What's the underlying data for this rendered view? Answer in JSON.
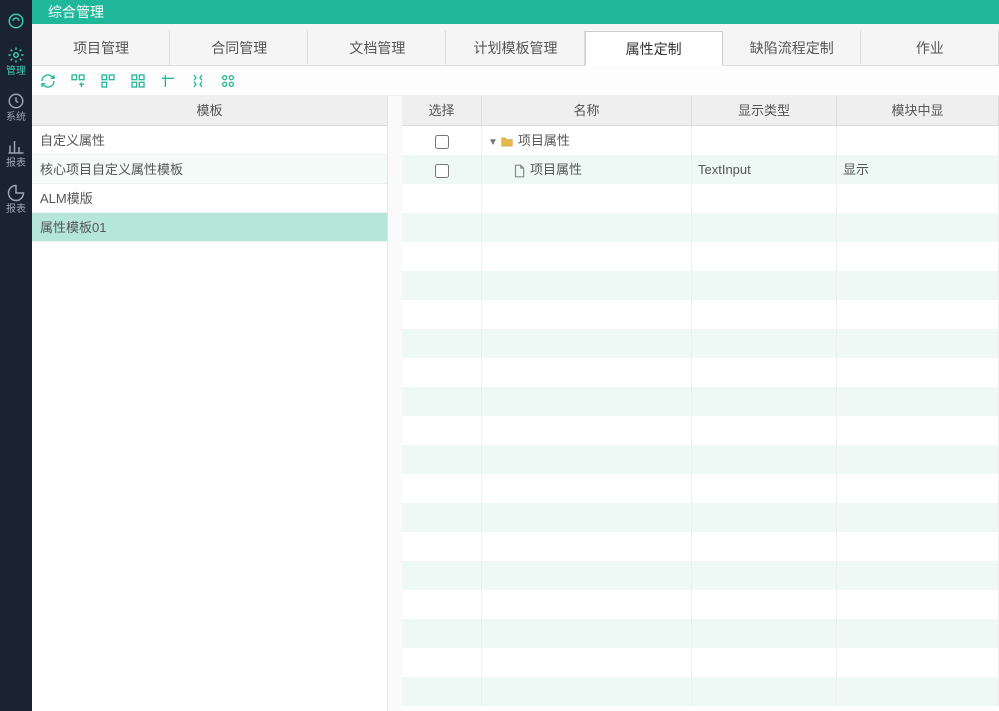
{
  "title": "综合管理",
  "sidebar": {
    "items": [
      {
        "label": ""
      },
      {
        "label": "管理"
      },
      {
        "label": "系统"
      },
      {
        "label": "报表"
      },
      {
        "label": "报表"
      }
    ]
  },
  "tabs": [
    {
      "label": "项目管理"
    },
    {
      "label": "合同管理"
    },
    {
      "label": "文档管理"
    },
    {
      "label": "计划模板管理"
    },
    {
      "label": "属性定制",
      "active": true
    },
    {
      "label": "缺陷流程定制"
    },
    {
      "label": "作业"
    }
  ],
  "leftPanel": {
    "header": "模板",
    "rows": [
      {
        "label": "自定义属性"
      },
      {
        "label": "核心项目自定义属性模板"
      },
      {
        "label": "ALM模版"
      },
      {
        "label": "属性模板01",
        "selected": true
      }
    ]
  },
  "rightPanel": {
    "headers": {
      "select": "选择",
      "name": "名称",
      "displayType": "显示类型",
      "moduleShow": "模块中显"
    },
    "rows": [
      {
        "name": "项目属性",
        "displayType": "",
        "moduleShow": "",
        "isFolder": true,
        "indent": 0
      },
      {
        "name": "项目属性",
        "displayType": "TextInput",
        "moduleShow": "显示",
        "isFolder": false,
        "indent": 1
      }
    ],
    "emptyRows": 18
  }
}
